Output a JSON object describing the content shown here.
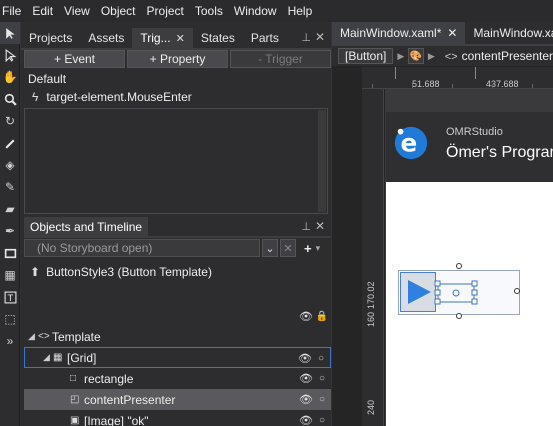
{
  "menu": [
    "File",
    "Edit",
    "View",
    "Object",
    "Project",
    "Tools",
    "Window",
    "Help"
  ],
  "tools": [
    "selection-icon",
    "direct-selection-icon",
    "pan-icon",
    "zoom-icon",
    "camera-orbit-icon",
    "eyedropper-icon",
    "paint-bucket-icon",
    "gradient-icon",
    "brush-icon",
    "pen-icon",
    "rectangle-icon",
    "grid-icon",
    "text-icon",
    "assets-icon",
    "more-icon"
  ],
  "left_tabs": [
    {
      "label": "Projects"
    },
    {
      "label": "Assets"
    },
    {
      "label": "Trig...",
      "close": "✕"
    },
    {
      "label": "States"
    },
    {
      "label": "Parts"
    }
  ],
  "pin_icon": "📌",
  "close_icon": "✕",
  "triggers": {
    "add_event": "+ Event",
    "add_property": "+ Property",
    "remove_trigger": "- Trigger",
    "default_label": "Default",
    "item": "target-element.MouseEnter"
  },
  "objects": {
    "title": "Objects and Timeline",
    "storyboard_placeholder": "(No Storyboard open)",
    "template_label": "ButtonStyle3 (Button Template)",
    "tree": [
      {
        "label": "Template",
        "indent": 0,
        "arrow": "◢",
        "icon": "<>",
        "boxed": false,
        "selected": false,
        "eye": false
      },
      {
        "label": "[Grid]",
        "indent": 1,
        "arrow": "◢",
        "icon": "▦",
        "boxed": true,
        "selected": false,
        "eye": true
      },
      {
        "label": "rectangle",
        "indent": 2,
        "arrow": "",
        "icon": "□",
        "boxed": false,
        "selected": false,
        "eye": true
      },
      {
        "label": "contentPresenter",
        "indent": 2,
        "arrow": "",
        "icon": "◰",
        "boxed": false,
        "selected": true,
        "eye": true
      },
      {
        "label": "[Image] \"ok\"",
        "indent": 2,
        "arrow": "",
        "icon": "▣",
        "boxed": false,
        "selected": false,
        "eye": true
      }
    ]
  },
  "doc": {
    "tabs": [
      {
        "label": "MainWindow.xaml*",
        "close": "✕"
      },
      {
        "label": "MainWindow.xam"
      }
    ],
    "crumb_button": "[Button]",
    "crumb_tail": "contentPresenter",
    "ruler_h": [
      "51.688",
      "437.688"
    ],
    "ruler_v": [
      "170.02",
      "160",
      "240"
    ],
    "brand": "OMRStudio",
    "app_title": "Ömer's Program"
  },
  "colors": {
    "accent": "#3c74c9",
    "play": "#2f80e0"
  }
}
